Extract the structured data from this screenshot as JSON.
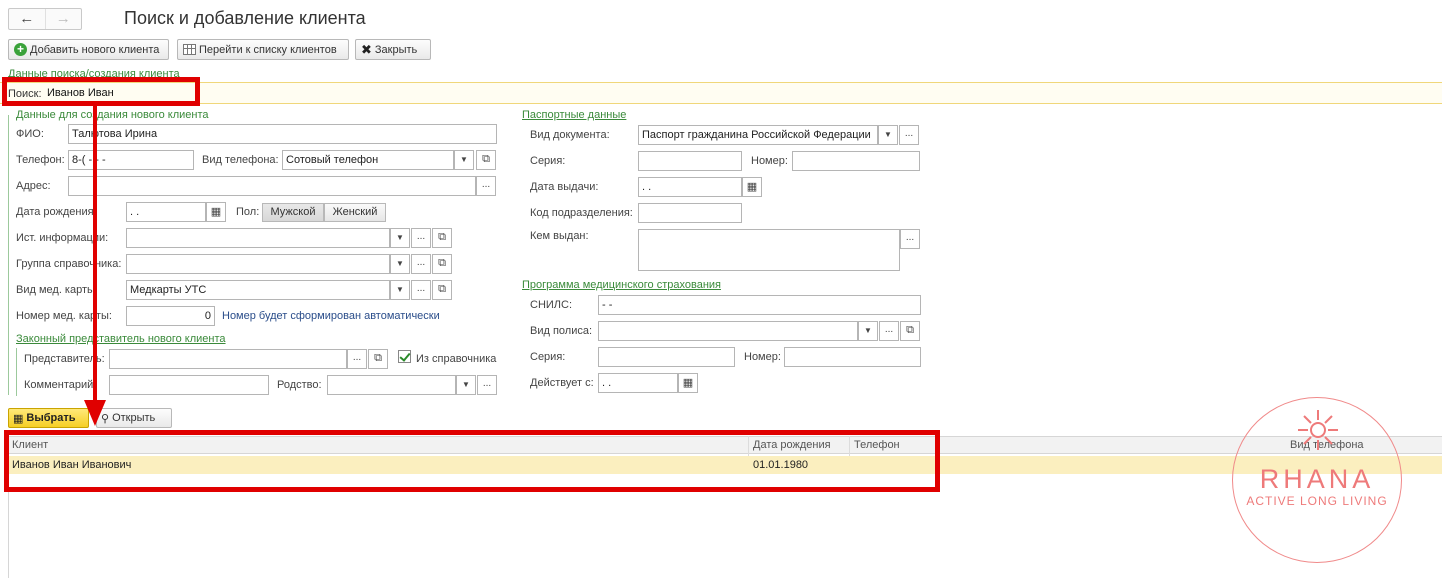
{
  "window": {
    "title": "Поиск и добавление клиента"
  },
  "toolbar": {
    "add_label": "Добавить нового клиента",
    "goto_list_label": "Перейти к списку клиентов",
    "close_label": "Закрыть"
  },
  "search_section": {
    "title": "Данные поиска/создания клиента",
    "label": "Поиск:",
    "value": "Иванов Иван"
  },
  "new_client": {
    "title": "Данные для создания нового клиента",
    "fio_label": "ФИО:",
    "fio_value": "Талютова Ирина",
    "phone_label": "Телефон:",
    "phone_value": "8-(    -   -  -",
    "phone_type_label": "Вид телефона:",
    "phone_type_value": "Сотовый телефон",
    "address_label": "Адрес:",
    "address_value": "",
    "birth_label": "Дата рождения:",
    "birth_value": " .  .",
    "gender_label": "Пол:",
    "gender_male": "Мужской",
    "gender_female": "Женский",
    "source_label": "Ист. информации:",
    "source_value": "",
    "group_label": "Группа справочника:",
    "group_value": "",
    "card_type_label": "Вид мед. карты:",
    "card_type_value": "Медкарты УТС",
    "card_num_label": "Номер мед. карты:",
    "card_num_value": "0",
    "card_num_note": "Номер будет сформирован автоматически"
  },
  "legal_rep": {
    "title": "Законный представитель нового клиента",
    "rep_label": "Представитель:",
    "rep_value": "",
    "from_ref_label": "Из справочника",
    "from_ref_checked": true,
    "comment_label": "Комментарий:",
    "comment_value": "",
    "relation_label": "Родство:",
    "relation_value": ""
  },
  "passport": {
    "title": "Паспортные данные",
    "doc_type_label": "Вид документа:",
    "doc_type_value": "Паспорт гражданина Российской Федерации",
    "series_label": "Серия:",
    "series_value": "",
    "number_label": "Номер:",
    "number_value": "",
    "issue_date_label": "Дата выдачи:",
    "issue_date_value": " .  .",
    "dept_code_label": "Код подразделения:",
    "dept_code_value": "",
    "issued_by_label": "Кем выдан:",
    "issued_by_value": ""
  },
  "insurance": {
    "title": "Программа медицинского страхования",
    "snils_label": "СНИЛС:",
    "snils_value": "   -   -",
    "policy_type_label": "Вид полиса:",
    "policy_type_value": "",
    "series_label": "Серия:",
    "series_value": "",
    "number_label": "Номер:",
    "number_value": "",
    "valid_from_label": "Действует с:",
    "valid_from_value": " .  ."
  },
  "results": {
    "select_label": "Выбрать",
    "open_label": "Открыть",
    "columns": [
      "Клиент",
      "Дата рождения",
      "Телефон",
      "Вид телефона"
    ],
    "rows": [
      {
        "client": "Иванов Иван Иванович",
        "birth": "01.01.1980",
        "phone": "",
        "phone_type": ""
      }
    ]
  },
  "watermark": {
    "brand": "RHANA",
    "tagline": "ACTIVE LONG LIVING"
  },
  "colors": {
    "highlight_row": "#fbefbf",
    "annotation_red": "#e00000",
    "section_green": "#3a8a3a",
    "logo_pink": "#ee7a7a"
  }
}
